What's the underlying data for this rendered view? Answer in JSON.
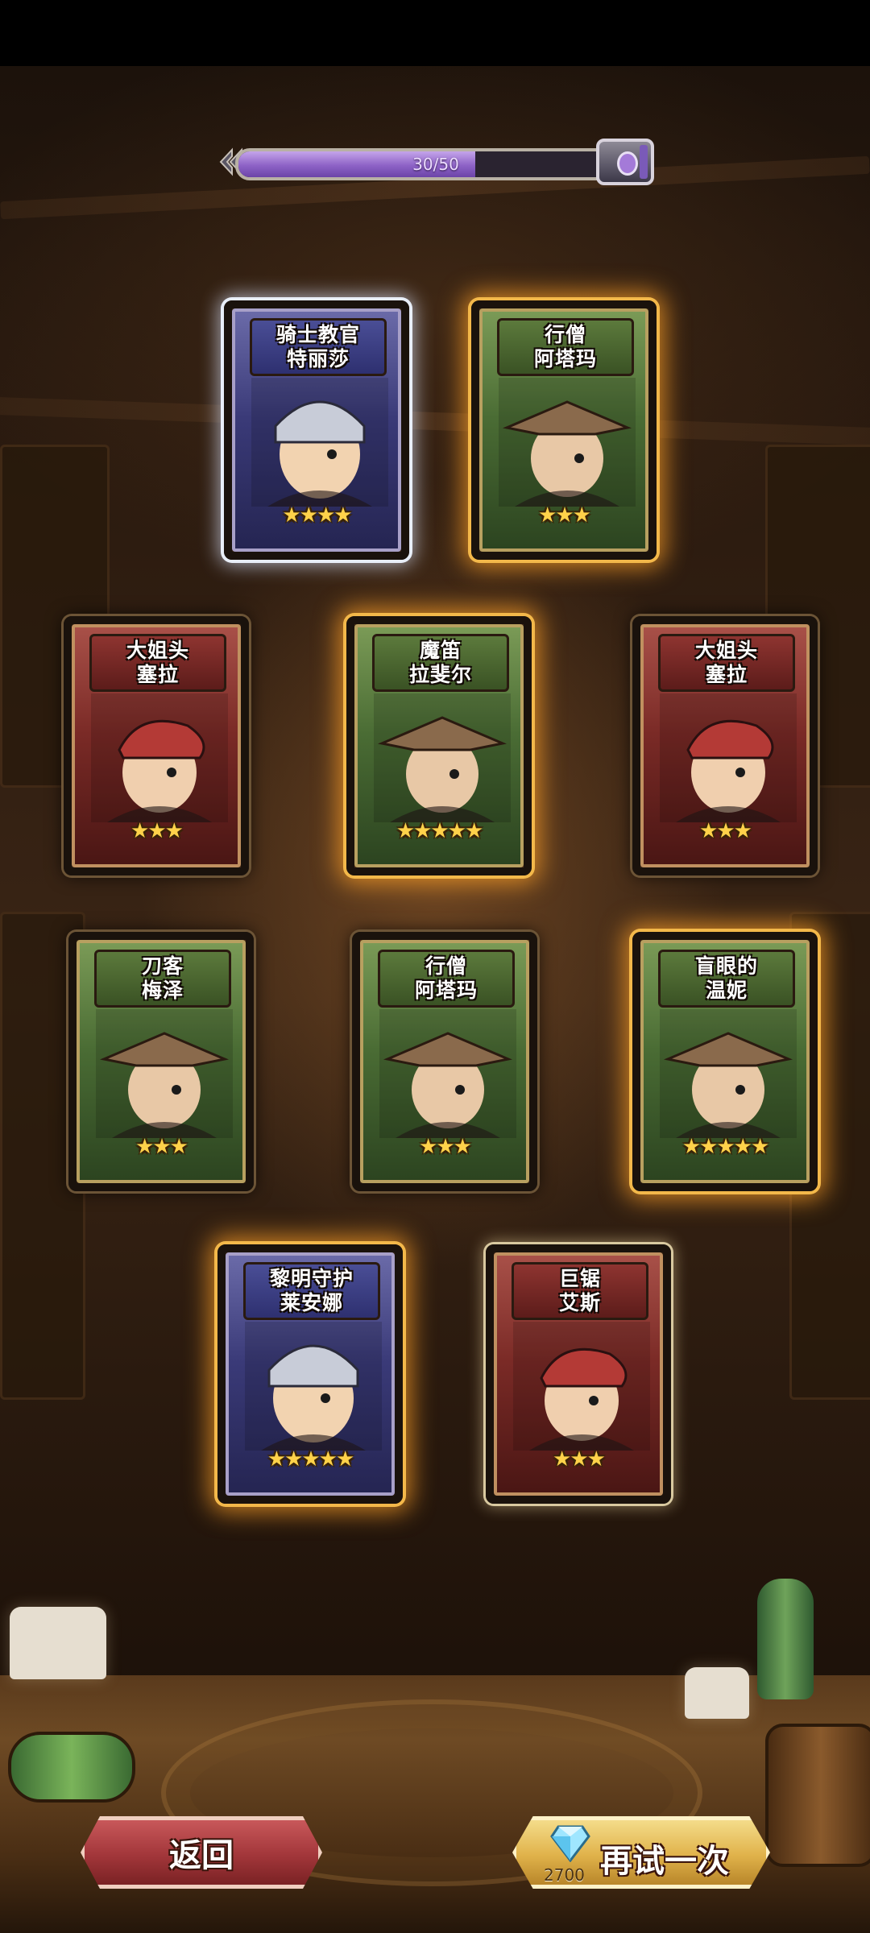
{
  "progress": {
    "text": "30/50",
    "value": 30,
    "max": 50
  },
  "cards": [
    {
      "title_line1": "骑士教官",
      "title_line2": "特丽莎",
      "stars": "★★★★",
      "star_count": 4,
      "frame": "blue",
      "glow": "white"
    },
    {
      "title_line1": "行僧",
      "title_line2": "阿塔玛",
      "stars": "★★★",
      "star_count": 3,
      "frame": "green",
      "glow": "gold"
    },
    {
      "title_line1": "大姐头",
      "title_line2": "塞拉",
      "stars": "★★★",
      "star_count": 3,
      "frame": "red",
      "glow": "none"
    },
    {
      "title_line1": "魔笛",
      "title_line2": "拉斐尔",
      "stars": "★★★★★",
      "star_count": 5,
      "frame": "green",
      "glow": "gold"
    },
    {
      "title_line1": "大姐头",
      "title_line2": "塞拉",
      "stars": "★★★",
      "star_count": 3,
      "frame": "red",
      "glow": "none"
    },
    {
      "title_line1": "刀客",
      "title_line2": "梅泽",
      "stars": "★★★",
      "star_count": 3,
      "frame": "green",
      "glow": "none"
    },
    {
      "title_line1": "行僧",
      "title_line2": "阿塔玛",
      "stars": "★★★",
      "star_count": 3,
      "frame": "green",
      "glow": "none"
    },
    {
      "title_line1": "盲眼的",
      "title_line2": "温妮",
      "stars": "★★★★★",
      "star_count": 5,
      "frame": "green",
      "glow": "gold"
    },
    {
      "title_line1": "黎明守护",
      "title_line2": "莱安娜",
      "stars": "★★★★★",
      "star_count": 5,
      "frame": "blue",
      "glow": "gold"
    },
    {
      "title_line1": "巨锯",
      "title_line2": "艾斯",
      "stars": "★★★",
      "star_count": 3,
      "frame": "red",
      "glow": "soft"
    }
  ],
  "buttons": {
    "back_label": "返回",
    "retry_label": "再试一次",
    "retry_cost": "2700",
    "retry_cost_icon": "diamond-icon"
  },
  "colors": {
    "progress_fill": "#8d62c6",
    "gold_glow": "#f3b84a",
    "back_button": "#a2363a",
    "retry_button": "#e0b24a"
  }
}
